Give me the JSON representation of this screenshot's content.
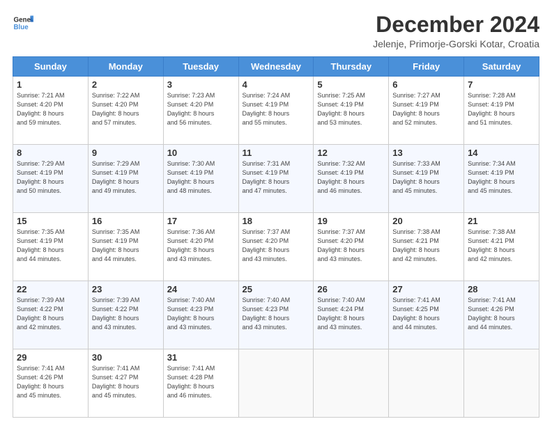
{
  "logo": {
    "line1": "General",
    "line2": "Blue"
  },
  "title": "December 2024",
  "subtitle": "Jelenje, Primorje-Gorski Kotar, Croatia",
  "weekdays": [
    "Sunday",
    "Monday",
    "Tuesday",
    "Wednesday",
    "Thursday",
    "Friday",
    "Saturday"
  ],
  "weeks": [
    [
      {
        "day": "1",
        "info": "Sunrise: 7:21 AM\nSunset: 4:20 PM\nDaylight: 8 hours\nand 59 minutes."
      },
      {
        "day": "2",
        "info": "Sunrise: 7:22 AM\nSunset: 4:20 PM\nDaylight: 8 hours\nand 57 minutes."
      },
      {
        "day": "3",
        "info": "Sunrise: 7:23 AM\nSunset: 4:20 PM\nDaylight: 8 hours\nand 56 minutes."
      },
      {
        "day": "4",
        "info": "Sunrise: 7:24 AM\nSunset: 4:19 PM\nDaylight: 8 hours\nand 55 minutes."
      },
      {
        "day": "5",
        "info": "Sunrise: 7:25 AM\nSunset: 4:19 PM\nDaylight: 8 hours\nand 53 minutes."
      },
      {
        "day": "6",
        "info": "Sunrise: 7:27 AM\nSunset: 4:19 PM\nDaylight: 8 hours\nand 52 minutes."
      },
      {
        "day": "7",
        "info": "Sunrise: 7:28 AM\nSunset: 4:19 PM\nDaylight: 8 hours\nand 51 minutes."
      }
    ],
    [
      {
        "day": "8",
        "info": "Sunrise: 7:29 AM\nSunset: 4:19 PM\nDaylight: 8 hours\nand 50 minutes."
      },
      {
        "day": "9",
        "info": "Sunrise: 7:29 AM\nSunset: 4:19 PM\nDaylight: 8 hours\nand 49 minutes."
      },
      {
        "day": "10",
        "info": "Sunrise: 7:30 AM\nSunset: 4:19 PM\nDaylight: 8 hours\nand 48 minutes."
      },
      {
        "day": "11",
        "info": "Sunrise: 7:31 AM\nSunset: 4:19 PM\nDaylight: 8 hours\nand 47 minutes."
      },
      {
        "day": "12",
        "info": "Sunrise: 7:32 AM\nSunset: 4:19 PM\nDaylight: 8 hours\nand 46 minutes."
      },
      {
        "day": "13",
        "info": "Sunrise: 7:33 AM\nSunset: 4:19 PM\nDaylight: 8 hours\nand 45 minutes."
      },
      {
        "day": "14",
        "info": "Sunrise: 7:34 AM\nSunset: 4:19 PM\nDaylight: 8 hours\nand 45 minutes."
      }
    ],
    [
      {
        "day": "15",
        "info": "Sunrise: 7:35 AM\nSunset: 4:19 PM\nDaylight: 8 hours\nand 44 minutes."
      },
      {
        "day": "16",
        "info": "Sunrise: 7:35 AM\nSunset: 4:19 PM\nDaylight: 8 hours\nand 44 minutes."
      },
      {
        "day": "17",
        "info": "Sunrise: 7:36 AM\nSunset: 4:20 PM\nDaylight: 8 hours\nand 43 minutes."
      },
      {
        "day": "18",
        "info": "Sunrise: 7:37 AM\nSunset: 4:20 PM\nDaylight: 8 hours\nand 43 minutes."
      },
      {
        "day": "19",
        "info": "Sunrise: 7:37 AM\nSunset: 4:20 PM\nDaylight: 8 hours\nand 43 minutes."
      },
      {
        "day": "20",
        "info": "Sunrise: 7:38 AM\nSunset: 4:21 PM\nDaylight: 8 hours\nand 42 minutes."
      },
      {
        "day": "21",
        "info": "Sunrise: 7:38 AM\nSunset: 4:21 PM\nDaylight: 8 hours\nand 42 minutes."
      }
    ],
    [
      {
        "day": "22",
        "info": "Sunrise: 7:39 AM\nSunset: 4:22 PM\nDaylight: 8 hours\nand 42 minutes."
      },
      {
        "day": "23",
        "info": "Sunrise: 7:39 AM\nSunset: 4:22 PM\nDaylight: 8 hours\nand 43 minutes."
      },
      {
        "day": "24",
        "info": "Sunrise: 7:40 AM\nSunset: 4:23 PM\nDaylight: 8 hours\nand 43 minutes."
      },
      {
        "day": "25",
        "info": "Sunrise: 7:40 AM\nSunset: 4:23 PM\nDaylight: 8 hours\nand 43 minutes."
      },
      {
        "day": "26",
        "info": "Sunrise: 7:40 AM\nSunset: 4:24 PM\nDaylight: 8 hours\nand 43 minutes."
      },
      {
        "day": "27",
        "info": "Sunrise: 7:41 AM\nSunset: 4:25 PM\nDaylight: 8 hours\nand 44 minutes."
      },
      {
        "day": "28",
        "info": "Sunrise: 7:41 AM\nSunset: 4:26 PM\nDaylight: 8 hours\nand 44 minutes."
      }
    ],
    [
      {
        "day": "29",
        "info": "Sunrise: 7:41 AM\nSunset: 4:26 PM\nDaylight: 8 hours\nand 45 minutes."
      },
      {
        "day": "30",
        "info": "Sunrise: 7:41 AM\nSunset: 4:27 PM\nDaylight: 8 hours\nand 45 minutes."
      },
      {
        "day": "31",
        "info": "Sunrise: 7:41 AM\nSunset: 4:28 PM\nDaylight: 8 hours\nand 46 minutes."
      },
      {
        "day": "",
        "info": ""
      },
      {
        "day": "",
        "info": ""
      },
      {
        "day": "",
        "info": ""
      },
      {
        "day": "",
        "info": ""
      }
    ]
  ]
}
